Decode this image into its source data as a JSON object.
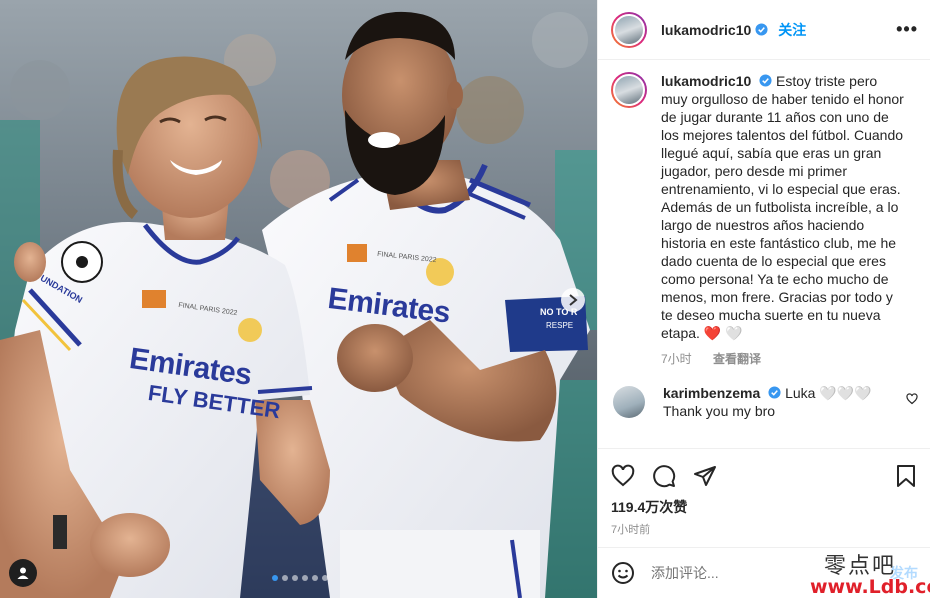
{
  "post": {
    "username": "lukamodric10",
    "follow_label": "关注",
    "more_label": "•••",
    "caption": "Estoy triste pero muy orgulloso de haber tenido el honor de jugar durante 11 años con uno de los mejores talentos del fútbol. Cuando llegué aquí, sabía que eras un gran jugador, pero desde mi primer entrenamiento, vi lo especial que eras. Además de un futbolista increíble, a lo largo de nuestros años haciendo historia en este fantástico club, me he dado cuenta de lo especial que eres como persona! Ya te echo mucho de menos, mon frere. Gracias por todo y te deseo mucha suerte en tu nueva etapa. ❤️ 🤍",
    "caption_time": "7小时",
    "translate_label": "查看翻译"
  },
  "comment": {
    "username": "karimbenzema",
    "text_line1": "Luka 🤍🤍🤍",
    "text_line2": "Thank you my bro"
  },
  "actions": {
    "likes": "119.4万次赞",
    "time": "7小时前"
  },
  "add_comment": {
    "placeholder": "添加评论...",
    "post_label": "发布"
  },
  "photo": {
    "jersey_sponsor_line1": "Emirates",
    "jersey_sponsor_line2": "FLY BETTER",
    "jersey_text": "FINAL PARIS 2022",
    "armband_line1": "NO TO R",
    "armband_line2": "RESPE",
    "sleeve_text": "UNDATION",
    "carousel_count": 6,
    "carousel_active": 0
  },
  "watermark": {
    "line1": "零点吧",
    "line2": "www.Ldb.cc"
  },
  "colors": {
    "link_blue": "#0095f6",
    "verified_blue": "#3897f0",
    "muted": "#8e8e8e",
    "madrid_blue": "#2a3a9a",
    "heart_red": "#e0245e"
  }
}
